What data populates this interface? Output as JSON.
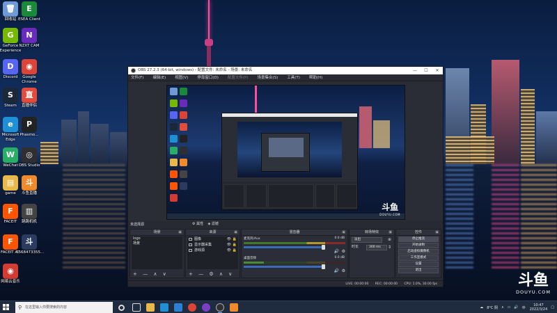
{
  "desktop": {
    "icons": [
      {
        "label": "回收站",
        "color": "#6f9ad6",
        "glyph": "🗑"
      },
      {
        "label": "ESEA Client",
        "color": "#1a8a3a",
        "glyph": "E"
      },
      {
        "label": "GeForce\nExperience",
        "color": "#76b900",
        "glyph": "G"
      },
      {
        "label": "NZXT CAM",
        "color": "#6a2bbd",
        "glyph": "N"
      },
      {
        "label": "Discord",
        "color": "#5865f2",
        "glyph": "D"
      },
      {
        "label": "Google\nChrome",
        "color": "#db4437",
        "glyph": "◉"
      },
      {
        "label": "Steam",
        "color": "#1b2838",
        "glyph": "S"
      },
      {
        "label": "直播伴侣",
        "color": "#e24c3c",
        "glyph": "直"
      },
      {
        "label": "Microsoft\nEdge",
        "color": "#1f8fd6",
        "glyph": "e"
      },
      {
        "label": "Phasmo...",
        "color": "#222222",
        "glyph": "P"
      },
      {
        "label": "WeChat",
        "color": "#2aae67",
        "glyph": "W"
      },
      {
        "label": "OBS Studio",
        "color": "#302e31",
        "glyph": "◎"
      },
      {
        "label": "game",
        "color": "#e8b84a",
        "glyph": "▤"
      },
      {
        "label": "斗鱼直播",
        "color": "#f08a2a",
        "glyph": "斗"
      },
      {
        "label": "FACEIT",
        "color": "#ff5500",
        "glyph": "F"
      },
      {
        "label": "跳跳机机",
        "color": "#444444",
        "glyph": "▥"
      },
      {
        "label": "FACEIT AC",
        "color": "#ff5500",
        "glyph": "F"
      },
      {
        "label": "6568473355...",
        "color": "#2a3b5f",
        "glyph": "斗"
      },
      {
        "label": "网易云音乐",
        "color": "#d43c33",
        "glyph": "◉"
      }
    ]
  },
  "obs": {
    "title": "OBS 27.2.3 (64-bit, windows) - 配置文件: 未命名 - 场景: 未命名",
    "window_buttons": {
      "minimize": "—",
      "maximize": "☐",
      "close": "✕"
    },
    "menu": [
      "文件(F)",
      "编辑(E)",
      "视图(V)",
      "停靠窗口(D)",
      "配置文件(P)",
      "场景集合(S)",
      "工具(T)",
      "帮助(H)"
    ],
    "preview_watermark": {
      "big": "斗鱼",
      "small": "DOUYU.COM"
    },
    "docks": {
      "scenes": {
        "title": "场景",
        "items": [
          "logo",
          "场景"
        ]
      },
      "sources": {
        "title": "来源",
        "items": [
          {
            "name": "图像",
            "icon": "image-icon"
          },
          {
            "name": "显示器采集",
            "icon": "monitor-icon"
          },
          {
            "name": "游戏源",
            "icon": "gamepad-icon"
          }
        ]
      },
      "mixer": {
        "title": "混音器",
        "channels": [
          {
            "name": "麦克风/Aux",
            "db": "0.0 dB",
            "level": 0.6
          },
          {
            "name": "桌面音频",
            "db": "0.0 dB",
            "level": 0.2
          }
        ]
      },
      "transitions": {
        "title": "转场特效",
        "type_value": "淡出",
        "duration_label": "时长",
        "duration_value": "300 ms"
      },
      "controls": {
        "title": "控件",
        "buttons": [
          "停止推流",
          "开始录制",
          "启动虚拟摄像机",
          "工作室模式",
          "设置",
          "退出"
        ]
      }
    },
    "scene_header": "未选择源",
    "source_header_props": "属性",
    "source_header_filters": "滤镜",
    "footer_icons": "+ — ∧ ∨",
    "source_footer_icons": "+ — ⚙ ∧ ∨",
    "status": {
      "live": "LIVE: 00:00:00",
      "rec": "REC: 00:00:00",
      "cpu": "CPU: 1.0%, 30.00 fps"
    }
  },
  "watermark": {
    "big": "斗鱼",
    "small": "DOUYU.COM"
  },
  "taskbar": {
    "search_placeholder": "在这里输入你要搜索的内容",
    "weather": "8°C 阴",
    "ime": "中",
    "time": "10:47",
    "date": "2022/3/24"
  }
}
